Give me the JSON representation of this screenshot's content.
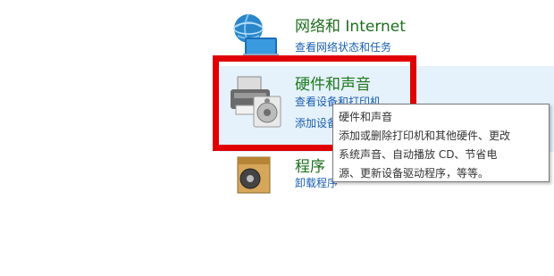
{
  "categories": [
    {
      "id": "network",
      "title": "网络和 Internet",
      "links": [
        "查看网络状态和任务"
      ],
      "icon": "network-globe-icon"
    },
    {
      "id": "hardware",
      "title": "硬件和声音",
      "links": [
        "查看设备和打印机",
        "添加设备"
      ],
      "icon": "printer-speaker-icon"
    },
    {
      "id": "programs",
      "title": "程序",
      "links": [
        "卸载程序"
      ],
      "icon": "programs-box-icon"
    }
  ],
  "tooltip": {
    "title": "硬件和声音",
    "lines": [
      "添加或删除打印机和其他硬件、更改",
      "系统声音、自动播放 CD、节省电",
      "源、更新设备驱动程序，等等。"
    ]
  },
  "colors": {
    "title_green": "#1e6e1e",
    "link_blue": "#1a5fb0",
    "highlight_red": "#e00000",
    "hover_bg": "#e5f1fb"
  }
}
